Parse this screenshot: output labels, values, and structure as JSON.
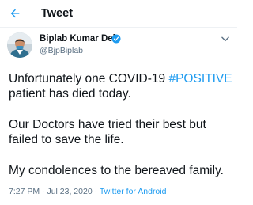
{
  "header": {
    "title": "Tweet",
    "back_icon": "arrow-left-icon"
  },
  "author": {
    "name": "Biplab Kumar Deb",
    "handle": "@BjpBiplab",
    "verified_icon": "verified-badge-icon",
    "more_icon": "chevron-down-icon"
  },
  "tweet": {
    "line1_before": "Unfortunately one COVID-19 ",
    "hashtag": "#POSITIVE",
    "line2": " patient has died today.",
    "paragraph2_line1": "Our Doctors have tried their best but",
    "paragraph2_line2": "failed to save the life.",
    "paragraph3": "My condolences to the bereaved family."
  },
  "meta": {
    "time": "7:27 PM",
    "separator1": " · ",
    "date": "Jul 23, 2020",
    "separator2": " · ",
    "source": "Twitter for Android"
  },
  "colors": {
    "accent": "#1d9bf0",
    "text": "#0f1419",
    "secondary": "#5b7083"
  }
}
